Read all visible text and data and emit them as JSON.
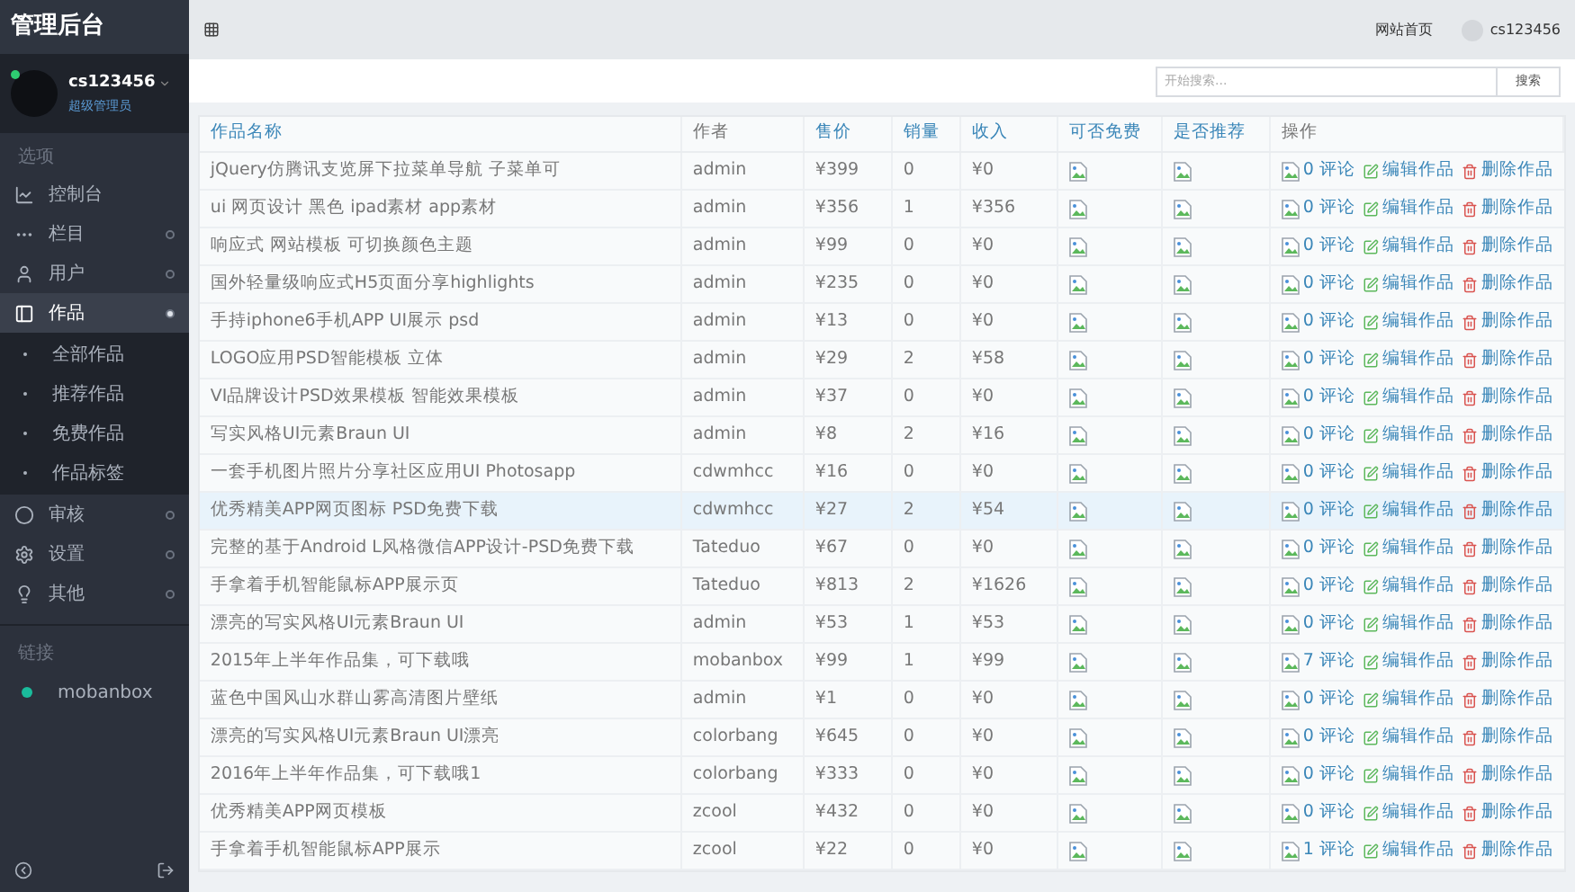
{
  "sidebar": {
    "title": "管理后台",
    "user": {
      "name": "cs123456",
      "role": "超级管理员",
      "online": true
    },
    "section_label": "选项",
    "items": [
      {
        "label": "控制台",
        "selected": false,
        "has_badge": false
      },
      {
        "label": "栏目",
        "selected": false,
        "has_badge": true
      },
      {
        "label": "用户",
        "selected": false,
        "has_badge": true
      },
      {
        "label": "作品",
        "selected": true,
        "has_badge": true,
        "children": [
          {
            "label": "全部作品"
          },
          {
            "label": "推荐作品"
          },
          {
            "label": "免费作品"
          },
          {
            "label": "作品标签"
          }
        ]
      },
      {
        "label": "审核",
        "selected": false,
        "has_badge": true
      },
      {
        "label": "设置",
        "selected": false,
        "has_badge": true
      },
      {
        "label": "其他",
        "selected": false,
        "has_badge": true
      }
    ],
    "links_label": "链接",
    "links": [
      {
        "label": "mobanbox",
        "color": "#1abc9c"
      }
    ]
  },
  "topbar": {
    "home_link": "网站首页",
    "user": "cs123456"
  },
  "search": {
    "placeholder": "开始搜索...",
    "button": "搜索"
  },
  "table": {
    "columns": [
      "作品名称",
      "作者",
      "售价",
      "销量",
      "收入",
      "可否免费",
      "是否推荐",
      "操作"
    ],
    "rows": [
      {
        "name": "jQuery仿腾讯支览屏下拉菜单导航 子菜单可",
        "author": "admin",
        "price": "¥399",
        "sales": "0",
        "income": "¥0",
        "comments": "0 评论",
        "edit": "编辑作品",
        "delete": "删除作品",
        "selected": false
      },
      {
        "name": "ui 网页设计 黑色 ipad素材 app素材",
        "author": "admin",
        "price": "¥356",
        "sales": "1",
        "income": "¥356",
        "comments": "0 评论",
        "edit": "编辑作品",
        "delete": "删除作品",
        "selected": false
      },
      {
        "name": "响应式 网站模板 可切换颜色主题",
        "author": "admin",
        "price": "¥99",
        "sales": "0",
        "income": "¥0",
        "comments": "0 评论",
        "edit": "编辑作品",
        "delete": "删除作品",
        "selected": false
      },
      {
        "name": "国外轻量级响应式H5页面分享highlights",
        "author": "admin",
        "price": "¥235",
        "sales": "0",
        "income": "¥0",
        "comments": "0 评论",
        "edit": "编辑作品",
        "delete": "删除作品",
        "selected": false
      },
      {
        "name": "手持iphone6手机APP UI展示 psd",
        "author": "admin",
        "price": "¥13",
        "sales": "0",
        "income": "¥0",
        "comments": "0 评论",
        "edit": "编辑作品",
        "delete": "删除作品",
        "selected": false
      },
      {
        "name": "LOGO应用PSD智能模板 立体",
        "author": "admin",
        "price": "¥29",
        "sales": "2",
        "income": "¥58",
        "comments": "0 评论",
        "edit": "编辑作品",
        "delete": "删除作品",
        "selected": false
      },
      {
        "name": "VI品牌设计PSD效果模板 智能效果模板",
        "author": "admin",
        "price": "¥37",
        "sales": "0",
        "income": "¥0",
        "comments": "0 评论",
        "edit": "编辑作品",
        "delete": "删除作品",
        "selected": false
      },
      {
        "name": "写实风格UI元素Braun UI",
        "author": "admin",
        "price": "¥8",
        "sales": "2",
        "income": "¥16",
        "comments": "0 评论",
        "edit": "编辑作品",
        "delete": "删除作品",
        "selected": false
      },
      {
        "name": "一套手机图片照片分享社区应用UI Photosapp",
        "author": "cdwmhcc",
        "price": "¥16",
        "sales": "0",
        "income": "¥0",
        "comments": "0 评论",
        "edit": "编辑作品",
        "delete": "删除作品",
        "selected": false
      },
      {
        "name": "优秀精美APP网页图标 PSD免费下载",
        "author": "cdwmhcc",
        "price": "¥27",
        "sales": "2",
        "income": "¥54",
        "comments": "0 评论",
        "edit": "编辑作品",
        "delete": "删除作品",
        "selected": true
      },
      {
        "name": "完整的基于Android L风格微信APP设计-PSD免费下载",
        "author": "Tateduo",
        "price": "¥67",
        "sales": "0",
        "income": "¥0",
        "comments": "0 评论",
        "edit": "编辑作品",
        "delete": "删除作品",
        "selected": false
      },
      {
        "name": "手拿着手机智能鼠标APP展示页",
        "author": "Tateduo",
        "price": "¥813",
        "sales": "2",
        "income": "¥1626",
        "comments": "0 评论",
        "edit": "编辑作品",
        "delete": "删除作品",
        "selected": false
      },
      {
        "name": "漂亮的写实风格UI元素Braun UI",
        "author": "admin",
        "price": "¥53",
        "sales": "1",
        "income": "¥53",
        "comments": "0 评论",
        "edit": "编辑作品",
        "delete": "删除作品",
        "selected": false
      },
      {
        "name": "2015年上半年作品集，可下载哦",
        "author": "mobanbox",
        "price": "¥99",
        "sales": "1",
        "income": "¥99",
        "comments": "7 评论",
        "edit": "编辑作品",
        "delete": "删除作品",
        "selected": false
      },
      {
        "name": "蓝色中国风山水群山雾高清图片壁纸",
        "author": "admin",
        "price": "¥1",
        "sales": "0",
        "income": "¥0",
        "comments": "0 评论",
        "edit": "编辑作品",
        "delete": "删除作品",
        "selected": false
      },
      {
        "name": "漂亮的写实风格UI元素Braun UI漂亮",
        "author": "colorbang",
        "price": "¥645",
        "sales": "0",
        "income": "¥0",
        "comments": "0 评论",
        "edit": "编辑作品",
        "delete": "删除作品",
        "selected": false
      },
      {
        "name": "2016年上半年作品集，可下载哦1",
        "author": "colorbang",
        "price": "¥333",
        "sales": "0",
        "income": "¥0",
        "comments": "0 评论",
        "edit": "编辑作品",
        "delete": "删除作品",
        "selected": false
      },
      {
        "name": "优秀精美APP网页模板",
        "author": "zcool",
        "price": "¥432",
        "sales": "0",
        "income": "¥0",
        "comments": "0 评论",
        "edit": "编辑作品",
        "delete": "删除作品",
        "selected": false
      },
      {
        "name": "手拿着手机智能鼠标APP展示",
        "author": "zcool",
        "price": "¥22",
        "sales": "0",
        "income": "¥0",
        "comments": "1 评论",
        "edit": "编辑作品",
        "delete": "删除作品",
        "selected": false
      }
    ]
  }
}
